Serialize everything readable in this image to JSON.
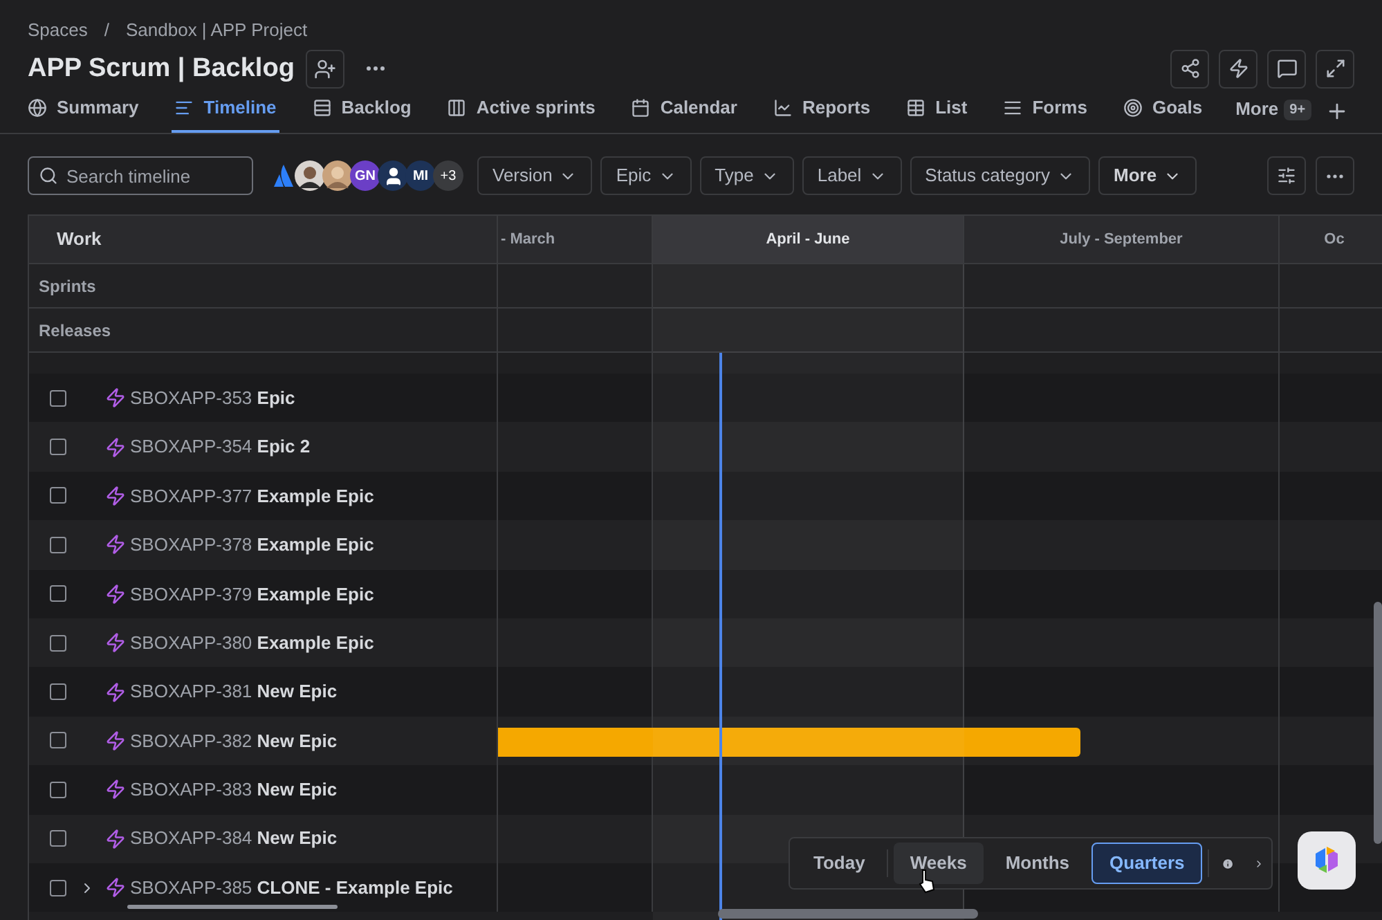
{
  "breadcrumbs": {
    "items": [
      "Spaces",
      "Sandbox | APP Project"
    ],
    "separator": "/"
  },
  "title": "APP Scrum | Backlog",
  "tabs": [
    {
      "label": "Summary",
      "selected": false
    },
    {
      "label": "Timeline",
      "selected": true
    },
    {
      "label": "Backlog",
      "selected": false
    },
    {
      "label": "Active sprints",
      "selected": false
    },
    {
      "label": "Calendar",
      "selected": false
    },
    {
      "label": "Reports",
      "selected": false
    },
    {
      "label": "List",
      "selected": false
    },
    {
      "label": "Forms",
      "selected": false
    },
    {
      "label": "Goals",
      "selected": false
    }
  ],
  "more_tab": {
    "label": "More",
    "badge": "9+"
  },
  "search": {
    "placeholder": "Search timeline"
  },
  "avatars": [
    {
      "kind": "logo"
    },
    {
      "kind": "photo"
    },
    {
      "kind": "photo"
    },
    {
      "kind": "initials",
      "text": "GN",
      "color": "#6b3fc6"
    },
    {
      "kind": "person",
      "color": "#1d3358"
    },
    {
      "kind": "initials",
      "text": "MI",
      "color": "#1d3358"
    },
    {
      "kind": "count",
      "text": "+3"
    }
  ],
  "filters": [
    "Version",
    "Epic",
    "Type",
    "Label",
    "Status category",
    "More"
  ],
  "timeline": {
    "work_header": "Work",
    "columns": [
      {
        "label": "- March",
        "current": false
      },
      {
        "label": "April - June",
        "current": true
      },
      {
        "label": "July - September",
        "current": false
      },
      {
        "label": "Oc",
        "current": false
      }
    ],
    "sections": [
      "Sprints",
      "Releases"
    ],
    "rows": [
      {
        "key": "SBOXAPP-353",
        "summary": "Epic",
        "expandable": false,
        "checked": false,
        "bar": false
      },
      {
        "key": "SBOXAPP-354",
        "summary": "Epic 2",
        "expandable": false,
        "checked": false,
        "bar": false
      },
      {
        "key": "SBOXAPP-377",
        "summary": "Example Epic",
        "expandable": false,
        "checked": false,
        "bar": false
      },
      {
        "key": "SBOXAPP-378",
        "summary": "Example Epic",
        "expandable": false,
        "checked": false,
        "bar": false
      },
      {
        "key": "SBOXAPP-379",
        "summary": "Example Epic",
        "expandable": false,
        "checked": false,
        "bar": false
      },
      {
        "key": "SBOXAPP-380",
        "summary": "Example Epic",
        "expandable": false,
        "checked": false,
        "bar": false
      },
      {
        "key": "SBOXAPP-381",
        "summary": "New Epic",
        "expandable": false,
        "checked": false,
        "bar": false
      },
      {
        "key": "SBOXAPP-382",
        "summary": "New Epic",
        "expandable": false,
        "checked": false,
        "bar": true
      },
      {
        "key": "SBOXAPP-383",
        "summary": "New Epic",
        "expandable": false,
        "checked": false,
        "bar": false
      },
      {
        "key": "SBOXAPP-384",
        "summary": "New Epic",
        "expandable": false,
        "checked": false,
        "bar": false
      },
      {
        "key": "SBOXAPP-385",
        "summary": "CLONE - Example Epic",
        "expandable": true,
        "checked": false,
        "bar": false
      }
    ]
  },
  "zoom_controls": [
    {
      "label": "Today",
      "selected": false,
      "hovered": false
    },
    {
      "label": "Weeks",
      "selected": false,
      "hovered": true
    },
    {
      "label": "Months",
      "selected": false,
      "hovered": false
    },
    {
      "label": "Quarters",
      "selected": true,
      "hovered": false
    }
  ]
}
